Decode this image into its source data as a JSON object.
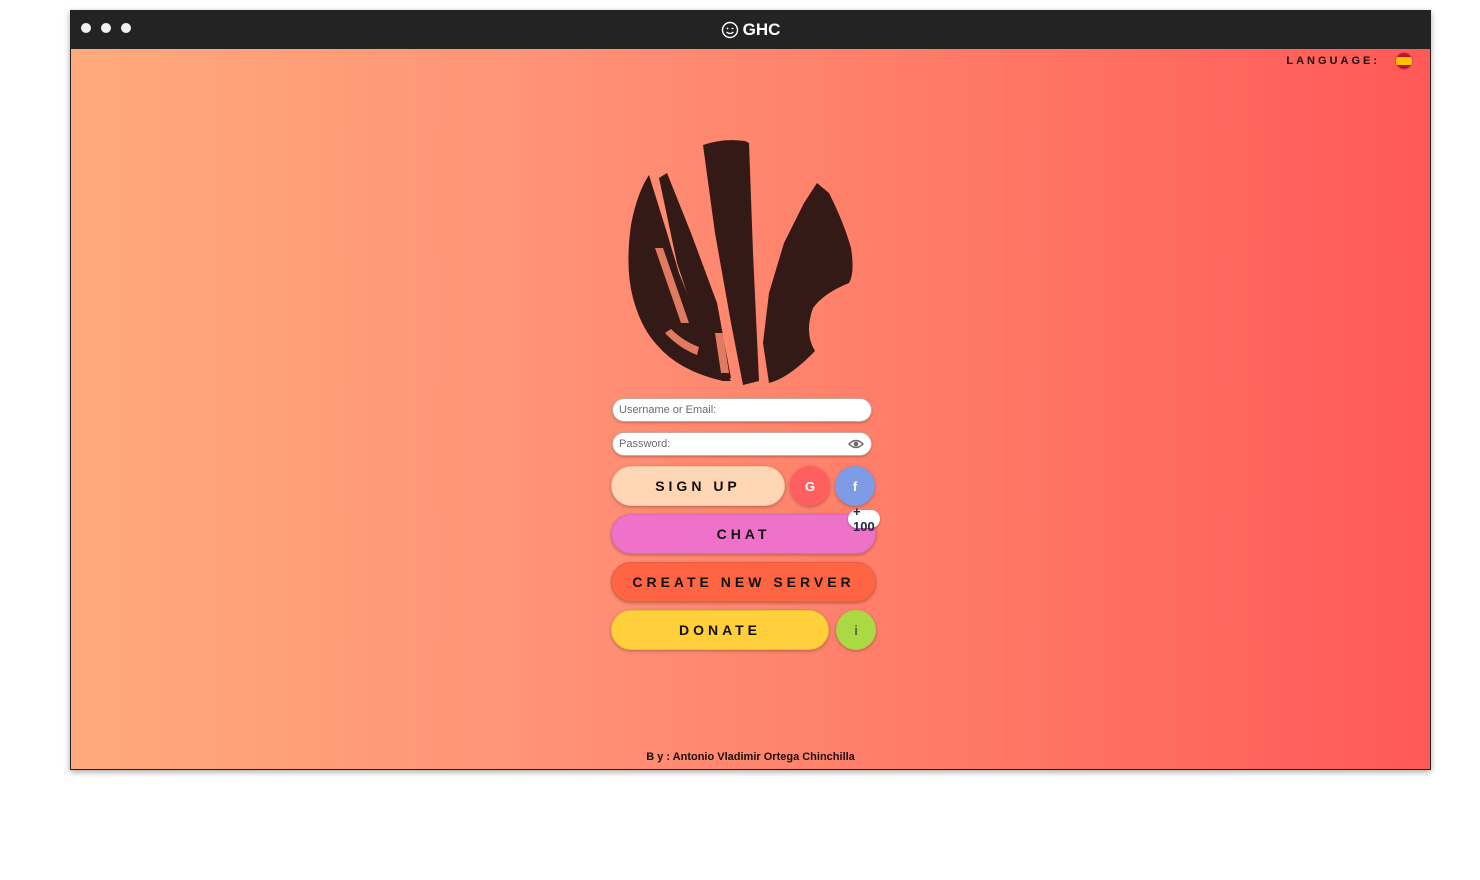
{
  "window": {
    "title": "GHC"
  },
  "language": {
    "label": "LANGUAGE:",
    "flag_icon": "spain-flag-icon"
  },
  "login": {
    "username_placeholder": "Username or Email:",
    "password_placeholder": "Password:",
    "signup_label": "SIGN UP",
    "google_label": "G",
    "facebook_label": "f",
    "chat_label": "CHAT",
    "chat_badge": "+ 100",
    "create_server_label": "CREATE NEW SERVER",
    "donate_label": "DONATE",
    "info_label": "i"
  },
  "footer": {
    "credit": "B y : Antonio Vladimir Ortega Chinchilla"
  },
  "colors": {
    "gradient_start": "#ffaa7c",
    "gradient_end": "#ff5957",
    "signup": "#ffd6b3",
    "google": "#ff5f5f",
    "facebook": "#7e9be6",
    "chat": "#ee72c7",
    "create_server": "#ff6543",
    "donate": "#ffd03c",
    "info": "#abd944",
    "logo": "#341a16"
  }
}
